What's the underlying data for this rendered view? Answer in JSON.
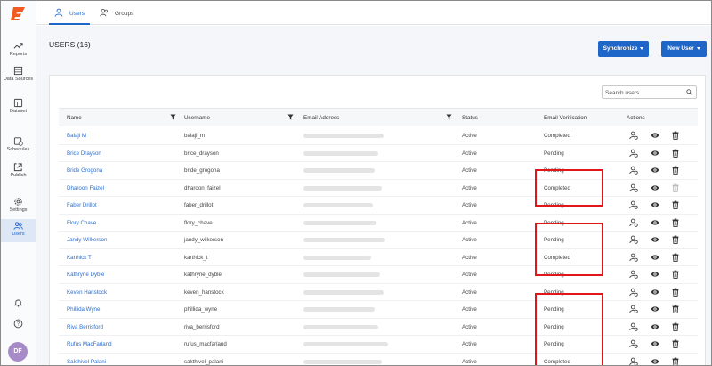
{
  "app": {
    "avatar_initials": "DF",
    "brand_color": "#f15a22",
    "accent_color": "#1f66c9"
  },
  "sidebar": {
    "items": [
      {
        "label": "Reports",
        "icon": "trending-up-icon"
      },
      {
        "label": "Data Sources",
        "icon": "database-icon"
      },
      {
        "label": "Dataset",
        "icon": "table-icon"
      },
      {
        "label": "Schedules",
        "icon": "calendar-clock-icon"
      },
      {
        "label": "Publish",
        "icon": "publish-icon"
      },
      {
        "label": "Settings",
        "icon": "gear-icon"
      },
      {
        "label": "Users",
        "icon": "users-icon",
        "active": true
      }
    ],
    "bottom_icons": [
      "bell-icon",
      "help-icon"
    ]
  },
  "tabs": [
    {
      "label": "Users",
      "active": true
    },
    {
      "label": "Groups",
      "active": false
    }
  ],
  "page": {
    "title": "USERS (16)",
    "synchronize_label": "Synchronize",
    "new_user_label": "New User"
  },
  "search": {
    "placeholder": "Search users"
  },
  "table": {
    "headers": {
      "name": "Name",
      "username": "Username",
      "email": "Email Address",
      "status": "Status",
      "verification": "Email Verification",
      "actions": "Actions"
    },
    "rows": [
      {
        "name": "Balaji M",
        "username": "balaji_m",
        "status": "Active",
        "verification": "Completed"
      },
      {
        "name": "Brice Drayson",
        "username": "brice_drayson",
        "status": "Active",
        "verification": "Pending"
      },
      {
        "name": "Bride Grogona",
        "username": "bride_grogona",
        "status": "Active",
        "verification": "Pending"
      },
      {
        "name": "Dharoon Faizel",
        "username": "dharoon_faizel",
        "status": "Active",
        "verification": "Completed"
      },
      {
        "name": "Faber Drillot",
        "username": "faber_drillot",
        "status": "Active",
        "verification": "Pending"
      },
      {
        "name": "Flory Chave",
        "username": "flory_chave",
        "status": "Active",
        "verification": "Pending"
      },
      {
        "name": "Jandy Wilkerson",
        "username": "jandy_wilkerson",
        "status": "Active",
        "verification": "Pending"
      },
      {
        "name": "Karthick T",
        "username": "karthick_t",
        "status": "Active",
        "verification": "Completed"
      },
      {
        "name": "Kathryne Dyble",
        "username": "kathryne_dyble",
        "status": "Active",
        "verification": "Pending"
      },
      {
        "name": "Keven Hanstock",
        "username": "keven_hanstock",
        "status": "Active",
        "verification": "Pending"
      },
      {
        "name": "Phillida Wyne",
        "username": "phillida_wyne",
        "status": "Active",
        "verification": "Pending"
      },
      {
        "name": "Riva Berrisford",
        "username": "riva_berrisford",
        "status": "Active",
        "verification": "Pending"
      },
      {
        "name": "Rufus MacFarland",
        "username": "rufus_macfarland",
        "status": "Active",
        "verification": "Pending"
      },
      {
        "name": "Sakthivel Palani",
        "username": "sakthivel_palani",
        "status": "Active",
        "verification": "Completed"
      }
    ]
  },
  "highlight_color": "#e0161b"
}
